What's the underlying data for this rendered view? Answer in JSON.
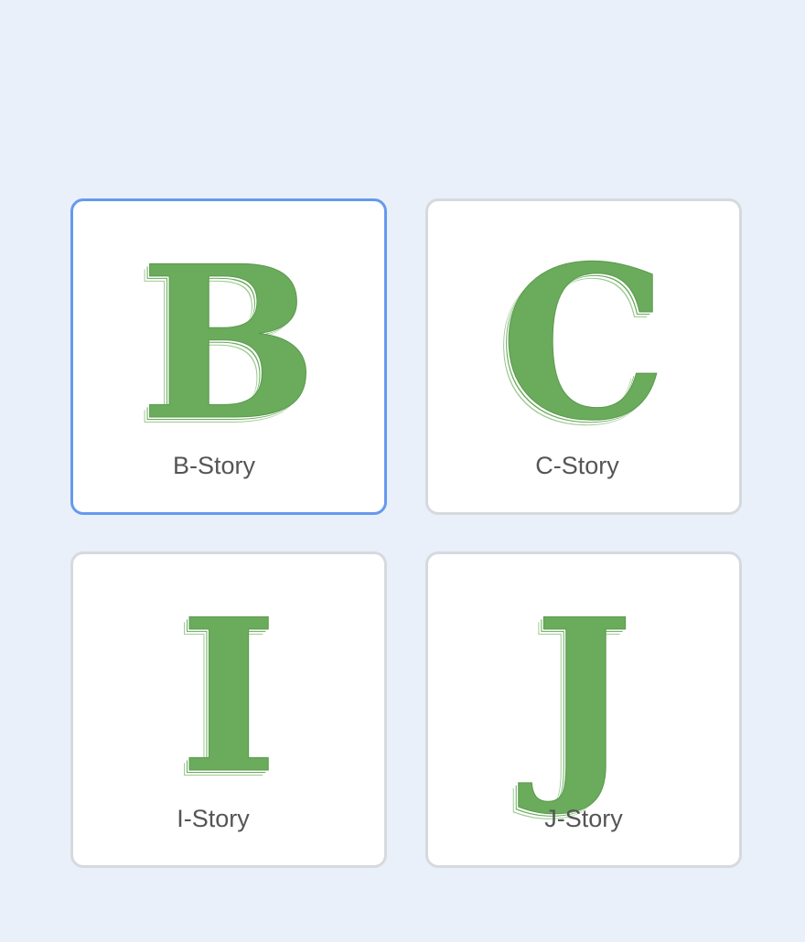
{
  "stories": [
    {
      "letter": "B",
      "label": "B-Story",
      "selected": true
    },
    {
      "letter": "C",
      "label": "C-Story",
      "selected": false
    },
    {
      "letter": "I",
      "label": "I-Story",
      "selected": false
    },
    {
      "letter": "J",
      "label": "J-Story",
      "selected": false
    }
  ],
  "colors": {
    "background": "#e9f0fa",
    "card": "#ffffff",
    "card_border": "#d6d9de",
    "selected_border": "#6699ee",
    "letter_green": "#6aab5c",
    "label_text": "#555555"
  },
  "icons": [
    "letter-b-icon",
    "letter-c-icon",
    "letter-i-icon",
    "letter-j-icon"
  ]
}
